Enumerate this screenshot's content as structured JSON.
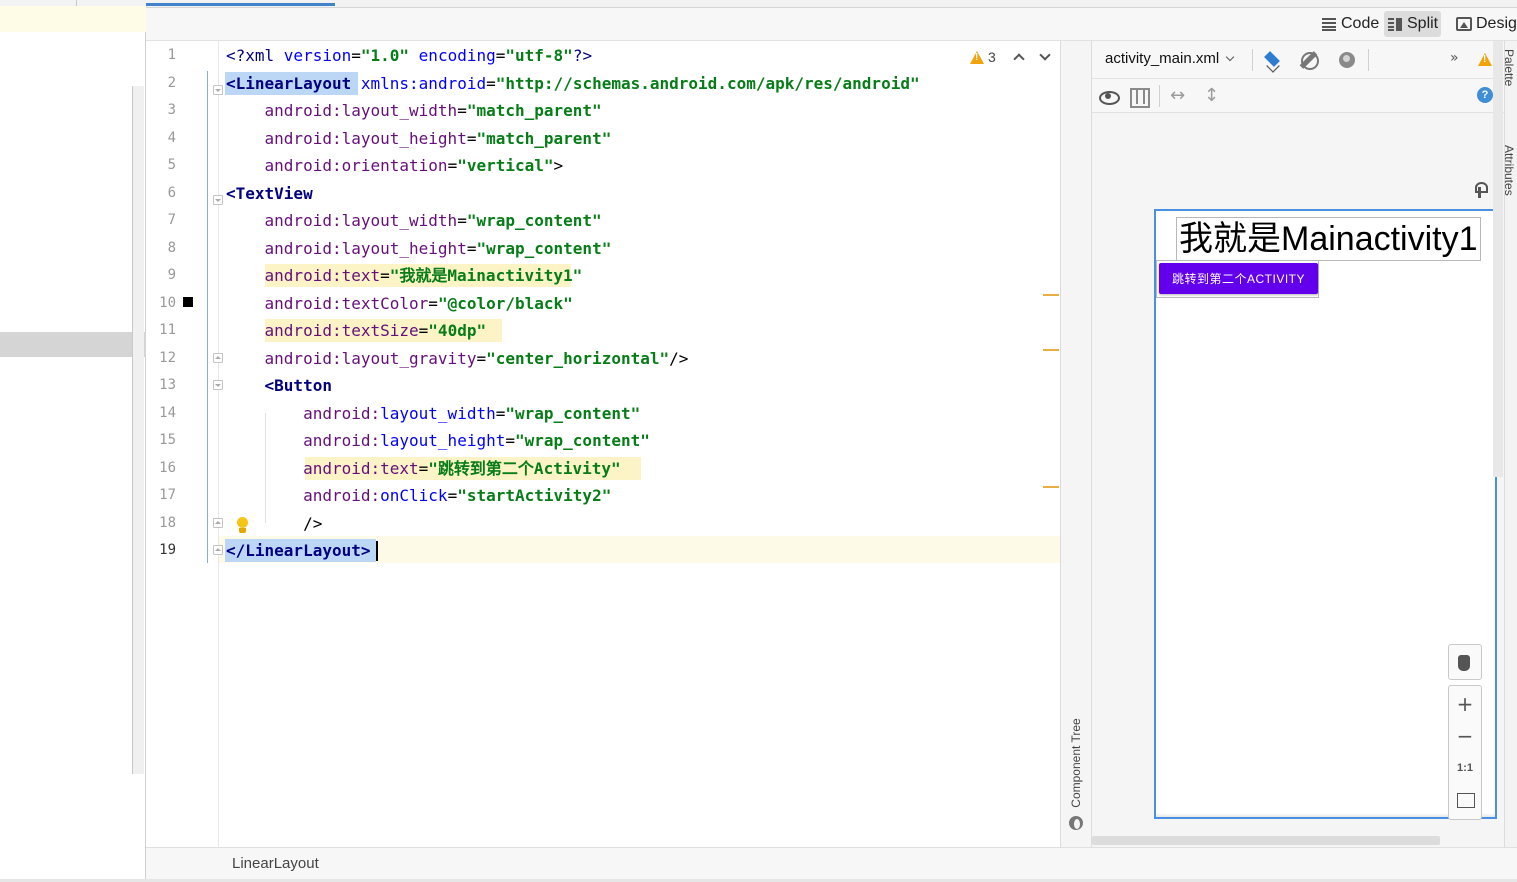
{
  "view_modes": [
    {
      "label": "Code",
      "icon": "code-view-icon",
      "active": false
    },
    {
      "label": "Split",
      "icon": "split-view-icon",
      "active": true
    },
    {
      "label": "Design",
      "icon": "design-view-icon",
      "active": false
    }
  ],
  "editor": {
    "line_numbers": [
      "1",
      "2",
      "3",
      "4",
      "5",
      "6",
      "7",
      "8",
      "9",
      "10",
      "11",
      "12",
      "13",
      "14",
      "15",
      "16",
      "17",
      "18",
      "19"
    ],
    "current_line": 19,
    "warnings_count": "3",
    "lines": [
      [
        [
          "<?",
          "pi"
        ],
        [
          "xml ",
          "pi"
        ],
        [
          "version",
          "attr"
        ],
        [
          "=",
          "punc"
        ],
        [
          "\"1.0\" ",
          "str"
        ],
        [
          "encoding",
          "attr"
        ],
        [
          "=",
          "punc"
        ],
        [
          "\"utf-8\"",
          "str"
        ],
        [
          "?>",
          "pi"
        ]
      ],
      [
        [
          "<LinearLayout",
          "tag-kw"
        ],
        [
          " ",
          "punc"
        ],
        [
          "xmlns:android",
          "attr"
        ],
        [
          "=",
          "punc"
        ],
        [
          "\"http://schemas.android.com/apk/res/android\"",
          "str"
        ]
      ],
      [
        [
          "    ",
          "punc"
        ],
        [
          "android:",
          "ns"
        ],
        [
          "layout_width",
          "ns"
        ],
        [
          "=",
          "punc"
        ],
        [
          "\"match_parent\"",
          "str"
        ]
      ],
      [
        [
          "    ",
          "punc"
        ],
        [
          "android:",
          "ns"
        ],
        [
          "layout_height",
          "ns"
        ],
        [
          "=",
          "punc"
        ],
        [
          "\"match_parent\"",
          "str"
        ]
      ],
      [
        [
          "    ",
          "punc"
        ],
        [
          "android:",
          "ns"
        ],
        [
          "orientation",
          "ns"
        ],
        [
          "=",
          "punc"
        ],
        [
          "\"vertical\"",
          "str"
        ],
        [
          ">",
          "punc"
        ]
      ],
      [
        [
          "<TextView",
          "tag-kw"
        ]
      ],
      [
        [
          "    ",
          "punc"
        ],
        [
          "android:",
          "ns"
        ],
        [
          "layout_width",
          "ns"
        ],
        [
          "=",
          "punc"
        ],
        [
          "\"wrap_content\"",
          "str"
        ]
      ],
      [
        [
          "    ",
          "punc"
        ],
        [
          "android:",
          "ns"
        ],
        [
          "layout_height",
          "ns"
        ],
        [
          "=",
          "punc"
        ],
        [
          "\"wrap_content\"",
          "str"
        ]
      ],
      [
        [
          "    ",
          "punc"
        ],
        [
          "android:",
          "ns"
        ],
        [
          "text",
          "ns"
        ],
        [
          "=",
          "punc"
        ],
        [
          "\"我就是Mainactivity1\"",
          "str"
        ]
      ],
      [
        [
          "    ",
          "punc"
        ],
        [
          "android:",
          "ns"
        ],
        [
          "textColor",
          "ns"
        ],
        [
          "=",
          "punc"
        ],
        [
          "\"@color/black\"",
          "str"
        ]
      ],
      [
        [
          "    ",
          "punc"
        ],
        [
          "android:",
          "ns"
        ],
        [
          "textSize",
          "ns"
        ],
        [
          "=",
          "punc"
        ],
        [
          "\"40dp\"",
          "str"
        ]
      ],
      [
        [
          "    ",
          "punc"
        ],
        [
          "android:",
          "ns"
        ],
        [
          "layout_gravity",
          "ns"
        ],
        [
          "=",
          "punc"
        ],
        [
          "\"center_horizontal\"",
          "str"
        ],
        [
          "/>",
          "punc"
        ]
      ],
      [
        [
          "    ",
          "punc"
        ],
        [
          "<Button",
          "tag-kw"
        ]
      ],
      [
        [
          "        ",
          "punc"
        ],
        [
          "android:",
          "ns"
        ],
        [
          "layout_width",
          "attr"
        ],
        [
          "=",
          "punc"
        ],
        [
          "\"wrap_content\"",
          "str"
        ]
      ],
      [
        [
          "        ",
          "punc"
        ],
        [
          "android:",
          "ns"
        ],
        [
          "layout_height",
          "attr"
        ],
        [
          "=",
          "punc"
        ],
        [
          "\"wrap_content\"",
          "str"
        ]
      ],
      [
        [
          "        ",
          "punc"
        ],
        [
          "android:",
          "ns"
        ],
        [
          "text",
          "ns"
        ],
        [
          "=",
          "punc"
        ],
        [
          "\"跳转到第二个Activity\"",
          "str"
        ]
      ],
      [
        [
          "        ",
          "punc"
        ],
        [
          "android:",
          "ns"
        ],
        [
          "onClick",
          "attr"
        ],
        [
          "=",
          "punc"
        ],
        [
          "\"startActivity2\"",
          "str"
        ]
      ],
      [
        [
          "        ",
          "punc"
        ],
        [
          "/>",
          "punc"
        ]
      ],
      [
        [
          "</LinearLayout>",
          "tag-kw"
        ]
      ]
    ]
  },
  "design": {
    "file_name": "activity_main.xml",
    "more_symbol": "»",
    "help_symbol": "?",
    "preview_text": "我就是Mainactivity1",
    "preview_button": "跳转到第二个ACTIVITY",
    "button_color": "#6200ee",
    "zoom": {
      "in": "+",
      "out": "−",
      "one_to_one": "1:1"
    }
  },
  "side_tabs": {
    "palette": "Palette",
    "attributes": "Attributes",
    "component_tree": "Component Tree"
  },
  "breadcrumb": "LinearLayout"
}
